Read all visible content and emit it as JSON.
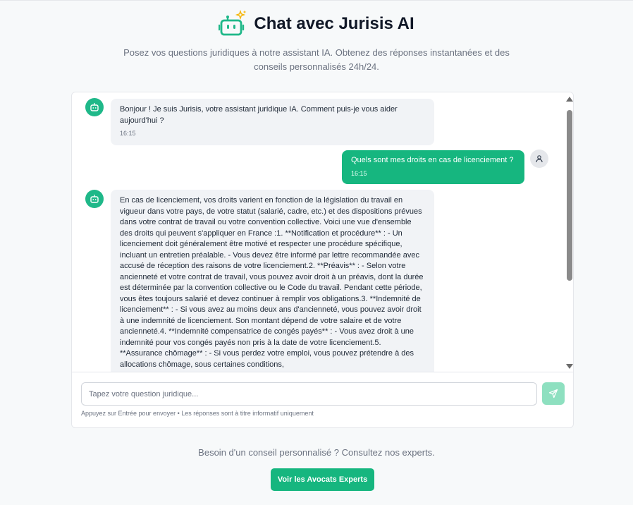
{
  "header": {
    "title": "Chat avec Jurisis AI",
    "subtitle": "Posez vos questions juridiques à notre assistant IA. Obtenez des réponses instantanées et des conseils personnalisés 24h/24."
  },
  "messages": [
    {
      "role": "bot",
      "text": "Bonjour ! Je suis Jurisis, votre assistant juridique IA. Comment puis-je vous aider aujourd'hui ?",
      "time": "16:15"
    },
    {
      "role": "user",
      "text": "Quels sont mes droits en cas de licenciement ?",
      "time": "16:15"
    },
    {
      "role": "bot",
      "text": "En cas de licenciement, vos droits varient en fonction de la législation du travail en vigueur dans votre pays, de votre statut (salarié, cadre, etc.) et des dispositions prévues dans votre contrat de travail ou votre convention collective. Voici une vue d'ensemble des droits qui peuvent s'appliquer en France :1. **Notification et procédure** : - Un licenciement doit généralement être motivé et respecter une procédure spécifique, incluant un entretien préalable. - Vous devez être informé par lettre recommandée avec accusé de réception des raisons de votre licenciement.2. **Préavis** : - Selon votre ancienneté et votre contrat de travail, vous pouvez avoir droit à un préavis, dont la durée est déterminée par la convention collective ou le Code du travail. Pendant cette période, vous êtes toujours salarié et devez continuer à remplir vos obligations.3. **Indemnité de licenciement** : - Si vous avez au moins deux ans d'ancienneté, vous pouvez avoir droit à une indemnité de licenciement. Son montant dépend de votre salaire et de votre ancienneté.4. **Indemnité compensatrice de congés payés** : - Vous avez droit à une indemnité pour vos congés payés non pris à la date de votre licenciement.5. **Assurance chômage** : - Si vous perdez votre emploi, vous pouvez prétendre à des allocations chômage, sous certaines conditions,"
    }
  ],
  "input": {
    "placeholder": "Tapez votre question juridique...",
    "hint": "Appuyez sur Entrée pour envoyer • Les réponses sont à titre informatif uniquement"
  },
  "cta": {
    "text": "Besoin d'un conseil personnalisé ? Consultez nos experts.",
    "button_label": "Voir les Avocats Experts"
  },
  "colors": {
    "accent": "#16b67f",
    "send_button_disabled": "#8ee0c0",
    "bot_bubble": "#f1f3f6"
  },
  "icons": {
    "logo": "robot-sparkle-icon",
    "bot_avatar": "robot-icon",
    "user_avatar": "user-icon",
    "send": "send-icon"
  }
}
